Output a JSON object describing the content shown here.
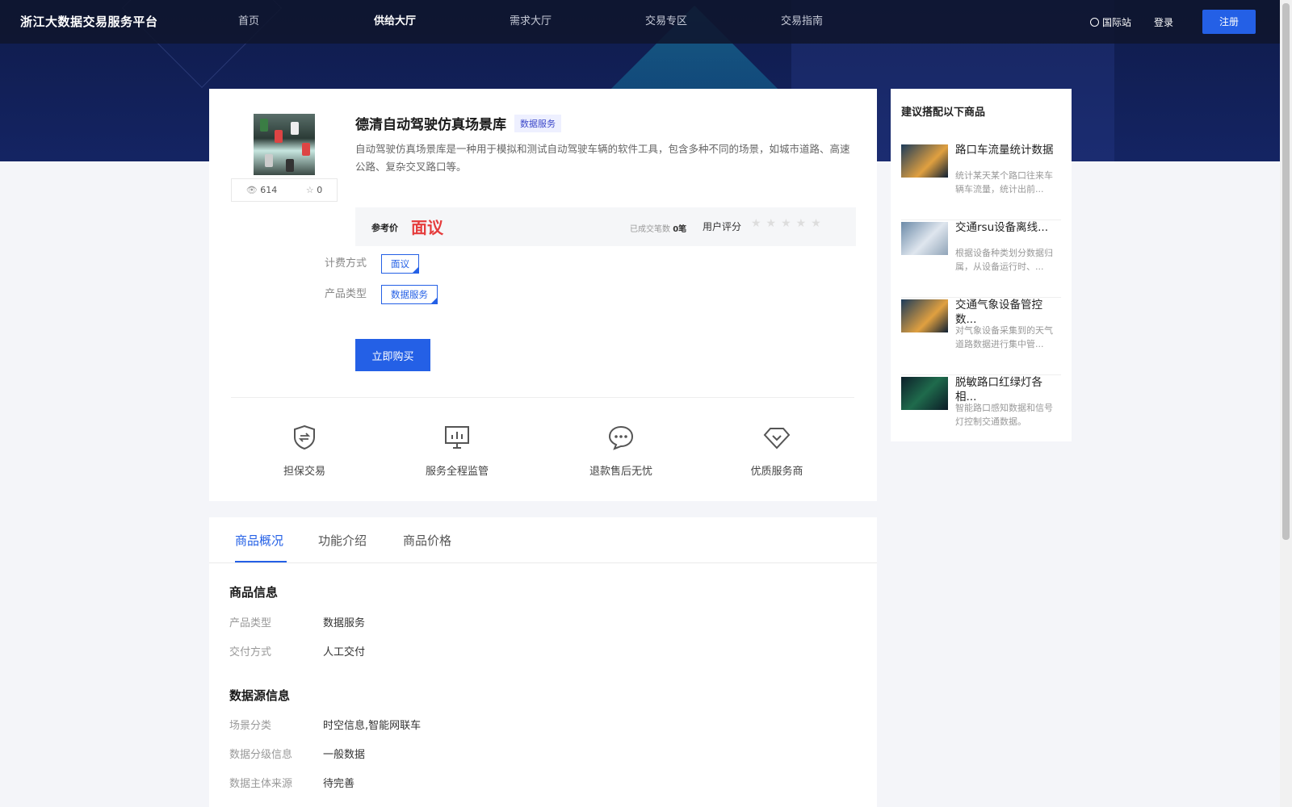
{
  "brand": "浙江大数据交易服务平台",
  "nav": [
    {
      "label": "首页",
      "active": false
    },
    {
      "label": "供给大厅",
      "active": true
    },
    {
      "label": "需求大厅",
      "active": false
    },
    {
      "label": "交易专区",
      "active": false
    },
    {
      "label": "交易指南",
      "active": false
    }
  ],
  "header": {
    "intl": "国际站",
    "login": "登录",
    "register": "注册"
  },
  "product": {
    "title": "德清自动驾驶仿真场景库",
    "tag": "数据服务",
    "description": "自动驾驶仿真场景库是一种用于模拟和测试自动驾驶车辆的软件工具，包含多种不同的场景，如城市道路、高速公路、复杂交叉路口等。",
    "views": "614",
    "favorites": "0",
    "price_label": "参考价",
    "price_value": "面议",
    "deals_label": "已成交笔数",
    "deals_value": "0笔",
    "rating_label": "用户评分",
    "stars": "★★★★★",
    "billing_label": "计费方式",
    "billing_option": "面议",
    "type_label": "产品类型",
    "type_option": "数据服务",
    "buy_label": "立即购买"
  },
  "features": [
    {
      "label": "担保交易",
      "icon": "shield-exchange-icon"
    },
    {
      "label": "服务全程监管",
      "icon": "monitor-chart-icon"
    },
    {
      "label": "退款售后无忧",
      "icon": "chat-bubble-icon"
    },
    {
      "label": "优质服务商",
      "icon": "diamond-icon"
    }
  ],
  "sidebar": {
    "title": "建议搭配以下商品",
    "items": [
      {
        "name": "路口车流量统计数据",
        "desc": "统计某天某个路口往来车辆车流量，统计出前..."
      },
      {
        "name": "交通rsu设备离线...",
        "desc": "根据设备种类划分数据归属，从设备运行时、..."
      },
      {
        "name": "交通气象设备管控数...",
        "desc": "对气象设备采集到的天气道路数据进行集中管..."
      },
      {
        "name": "脱敏路口红绿灯各相...",
        "desc": "智能路口感知数据和信号灯控制交通数据。"
      }
    ]
  },
  "tabs": [
    "商品概况",
    "功能介绍",
    "商品价格"
  ],
  "info": {
    "section1": "商品信息",
    "rows1": [
      {
        "label": "产品类型",
        "value": "数据服务"
      },
      {
        "label": "交付方式",
        "value": "人工交付"
      }
    ],
    "section2": "数据源信息",
    "rows2": [
      {
        "label": "场景分类",
        "value": "时空信息,智能网联车"
      },
      {
        "label": "数据分级信息",
        "value": "一般数据"
      },
      {
        "label": "数据主体来源",
        "value": "待完善"
      }
    ]
  },
  "colors": {
    "primary": "#2460e6",
    "price": "#e53c3c",
    "header_bg": "#0f1b4a"
  }
}
